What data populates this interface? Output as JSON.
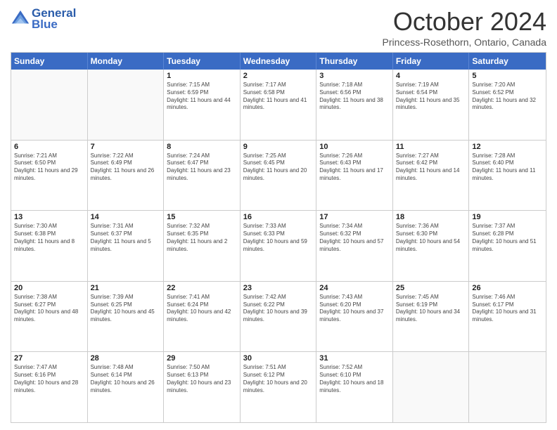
{
  "logo": {
    "line1": "General",
    "line2": "Blue"
  },
  "title": "October 2024",
  "subtitle": "Princess-Rosethorn, Ontario, Canada",
  "header_days": [
    "Sunday",
    "Monday",
    "Tuesday",
    "Wednesday",
    "Thursday",
    "Friday",
    "Saturday"
  ],
  "rows": [
    [
      {
        "day": "",
        "sunrise": "",
        "sunset": "",
        "daylight": ""
      },
      {
        "day": "",
        "sunrise": "",
        "sunset": "",
        "daylight": ""
      },
      {
        "day": "1",
        "sunrise": "Sunrise: 7:15 AM",
        "sunset": "Sunset: 6:59 PM",
        "daylight": "Daylight: 11 hours and 44 minutes."
      },
      {
        "day": "2",
        "sunrise": "Sunrise: 7:17 AM",
        "sunset": "Sunset: 6:58 PM",
        "daylight": "Daylight: 11 hours and 41 minutes."
      },
      {
        "day": "3",
        "sunrise": "Sunrise: 7:18 AM",
        "sunset": "Sunset: 6:56 PM",
        "daylight": "Daylight: 11 hours and 38 minutes."
      },
      {
        "day": "4",
        "sunrise": "Sunrise: 7:19 AM",
        "sunset": "Sunset: 6:54 PM",
        "daylight": "Daylight: 11 hours and 35 minutes."
      },
      {
        "day": "5",
        "sunrise": "Sunrise: 7:20 AM",
        "sunset": "Sunset: 6:52 PM",
        "daylight": "Daylight: 11 hours and 32 minutes."
      }
    ],
    [
      {
        "day": "6",
        "sunrise": "Sunrise: 7:21 AM",
        "sunset": "Sunset: 6:50 PM",
        "daylight": "Daylight: 11 hours and 29 minutes."
      },
      {
        "day": "7",
        "sunrise": "Sunrise: 7:22 AM",
        "sunset": "Sunset: 6:49 PM",
        "daylight": "Daylight: 11 hours and 26 minutes."
      },
      {
        "day": "8",
        "sunrise": "Sunrise: 7:24 AM",
        "sunset": "Sunset: 6:47 PM",
        "daylight": "Daylight: 11 hours and 23 minutes."
      },
      {
        "day": "9",
        "sunrise": "Sunrise: 7:25 AM",
        "sunset": "Sunset: 6:45 PM",
        "daylight": "Daylight: 11 hours and 20 minutes."
      },
      {
        "day": "10",
        "sunrise": "Sunrise: 7:26 AM",
        "sunset": "Sunset: 6:43 PM",
        "daylight": "Daylight: 11 hours and 17 minutes."
      },
      {
        "day": "11",
        "sunrise": "Sunrise: 7:27 AM",
        "sunset": "Sunset: 6:42 PM",
        "daylight": "Daylight: 11 hours and 14 minutes."
      },
      {
        "day": "12",
        "sunrise": "Sunrise: 7:28 AM",
        "sunset": "Sunset: 6:40 PM",
        "daylight": "Daylight: 11 hours and 11 minutes."
      }
    ],
    [
      {
        "day": "13",
        "sunrise": "Sunrise: 7:30 AM",
        "sunset": "Sunset: 6:38 PM",
        "daylight": "Daylight: 11 hours and 8 minutes."
      },
      {
        "day": "14",
        "sunrise": "Sunrise: 7:31 AM",
        "sunset": "Sunset: 6:37 PM",
        "daylight": "Daylight: 11 hours and 5 minutes."
      },
      {
        "day": "15",
        "sunrise": "Sunrise: 7:32 AM",
        "sunset": "Sunset: 6:35 PM",
        "daylight": "Daylight: 11 hours and 2 minutes."
      },
      {
        "day": "16",
        "sunrise": "Sunrise: 7:33 AM",
        "sunset": "Sunset: 6:33 PM",
        "daylight": "Daylight: 10 hours and 59 minutes."
      },
      {
        "day": "17",
        "sunrise": "Sunrise: 7:34 AM",
        "sunset": "Sunset: 6:32 PM",
        "daylight": "Daylight: 10 hours and 57 minutes."
      },
      {
        "day": "18",
        "sunrise": "Sunrise: 7:36 AM",
        "sunset": "Sunset: 6:30 PM",
        "daylight": "Daylight: 10 hours and 54 minutes."
      },
      {
        "day": "19",
        "sunrise": "Sunrise: 7:37 AM",
        "sunset": "Sunset: 6:28 PM",
        "daylight": "Daylight: 10 hours and 51 minutes."
      }
    ],
    [
      {
        "day": "20",
        "sunrise": "Sunrise: 7:38 AM",
        "sunset": "Sunset: 6:27 PM",
        "daylight": "Daylight: 10 hours and 48 minutes."
      },
      {
        "day": "21",
        "sunrise": "Sunrise: 7:39 AM",
        "sunset": "Sunset: 6:25 PM",
        "daylight": "Daylight: 10 hours and 45 minutes."
      },
      {
        "day": "22",
        "sunrise": "Sunrise: 7:41 AM",
        "sunset": "Sunset: 6:24 PM",
        "daylight": "Daylight: 10 hours and 42 minutes."
      },
      {
        "day": "23",
        "sunrise": "Sunrise: 7:42 AM",
        "sunset": "Sunset: 6:22 PM",
        "daylight": "Daylight: 10 hours and 39 minutes."
      },
      {
        "day": "24",
        "sunrise": "Sunrise: 7:43 AM",
        "sunset": "Sunset: 6:20 PM",
        "daylight": "Daylight: 10 hours and 37 minutes."
      },
      {
        "day": "25",
        "sunrise": "Sunrise: 7:45 AM",
        "sunset": "Sunset: 6:19 PM",
        "daylight": "Daylight: 10 hours and 34 minutes."
      },
      {
        "day": "26",
        "sunrise": "Sunrise: 7:46 AM",
        "sunset": "Sunset: 6:17 PM",
        "daylight": "Daylight: 10 hours and 31 minutes."
      }
    ],
    [
      {
        "day": "27",
        "sunrise": "Sunrise: 7:47 AM",
        "sunset": "Sunset: 6:16 PM",
        "daylight": "Daylight: 10 hours and 28 minutes."
      },
      {
        "day": "28",
        "sunrise": "Sunrise: 7:48 AM",
        "sunset": "Sunset: 6:14 PM",
        "daylight": "Daylight: 10 hours and 26 minutes."
      },
      {
        "day": "29",
        "sunrise": "Sunrise: 7:50 AM",
        "sunset": "Sunset: 6:13 PM",
        "daylight": "Daylight: 10 hours and 23 minutes."
      },
      {
        "day": "30",
        "sunrise": "Sunrise: 7:51 AM",
        "sunset": "Sunset: 6:12 PM",
        "daylight": "Daylight: 10 hours and 20 minutes."
      },
      {
        "day": "31",
        "sunrise": "Sunrise: 7:52 AM",
        "sunset": "Sunset: 6:10 PM",
        "daylight": "Daylight: 10 hours and 18 minutes."
      },
      {
        "day": "",
        "sunrise": "",
        "sunset": "",
        "daylight": ""
      },
      {
        "day": "",
        "sunrise": "",
        "sunset": "",
        "daylight": ""
      }
    ]
  ]
}
